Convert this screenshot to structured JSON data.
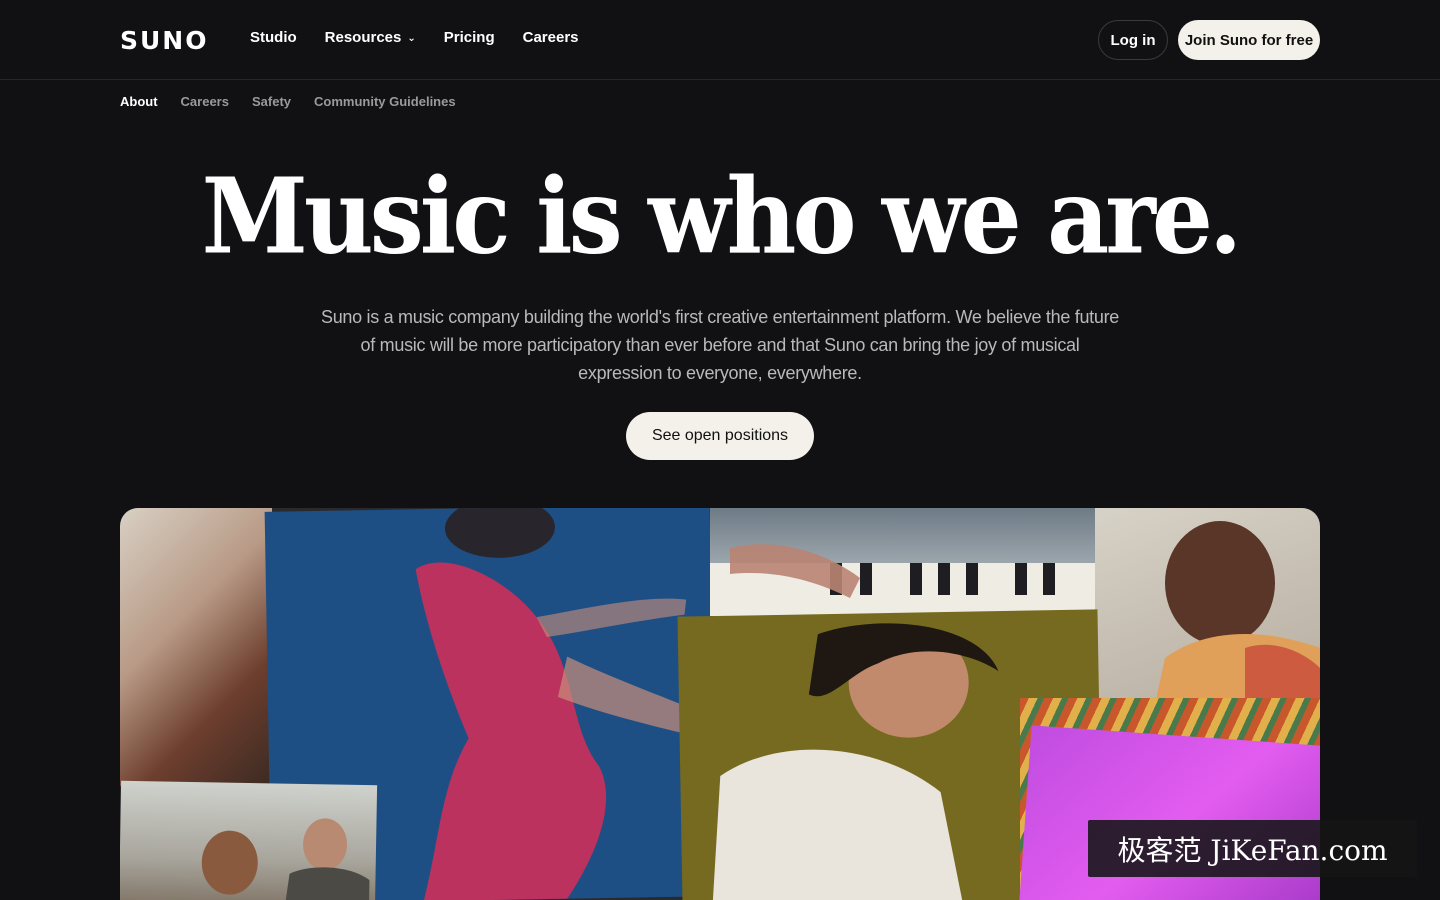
{
  "header": {
    "logo": "SUNO",
    "nav": [
      {
        "label": "Studio"
      },
      {
        "label": "Resources",
        "has_dropdown": true
      },
      {
        "label": "Pricing"
      },
      {
        "label": "Careers"
      }
    ],
    "login_label": "Log in",
    "join_label": "Join Suno for free"
  },
  "subnav": [
    {
      "label": "About",
      "active": true
    },
    {
      "label": "Careers"
    },
    {
      "label": "Safety"
    },
    {
      "label": "Community Guidelines"
    }
  ],
  "hero": {
    "title": "Music is who we are.",
    "description": "Suno is a music company building the world's first creative entertainment platform. We believe the future of music will be more participatory than ever before and that Suno can bring the joy of musical expression to everyone, everywhere.",
    "cta_label": "See open positions"
  },
  "watermark": "极客范 JiKeFan.com",
  "colors": {
    "background": "#111114",
    "button_light": "#f4f1ea",
    "muted_text": "#b9b9bd"
  }
}
